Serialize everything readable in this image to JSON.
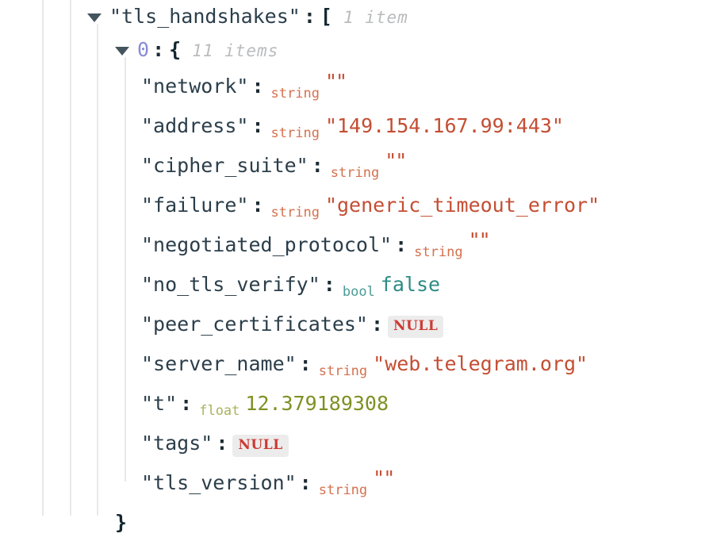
{
  "viewer": {
    "root": {
      "key": "\"tls_handshakes\"",
      "colon": ":",
      "bracket": "[",
      "count": "1 item",
      "expanded_icon": "triangle-down-icon"
    },
    "item": {
      "index": "0",
      "colon": ":",
      "bracket": "{",
      "count": "11 items",
      "expanded_icon": "triangle-down-icon"
    },
    "closing_brace": "}",
    "colon": ":",
    "fields": [
      {
        "key": "\"network\"",
        "type": "string",
        "value": "\"\"",
        "value_kind": "empty-string"
      },
      {
        "key": "\"address\"",
        "type": "string",
        "value": "\"149.154.167.99:443\"",
        "value_kind": "string"
      },
      {
        "key": "\"cipher_suite\"",
        "type": "string",
        "value": "\"\"",
        "value_kind": "empty-string"
      },
      {
        "key": "\"failure\"",
        "type": "string",
        "value": "\"generic_timeout_error\"",
        "value_kind": "string"
      },
      {
        "key": "\"negotiated_protocol\"",
        "type": "string",
        "value": "\"\"",
        "value_kind": "empty-string"
      },
      {
        "key": "\"no_tls_verify\"",
        "type": "bool",
        "value": "false",
        "value_kind": "bool"
      },
      {
        "key": "\"peer_certificates\"",
        "type": "",
        "value": "NULL",
        "value_kind": "null"
      },
      {
        "key": "\"server_name\"",
        "type": "string",
        "value": "\"web.telegram.org\"",
        "value_kind": "string"
      },
      {
        "key": "\"t\"",
        "type": "float",
        "value": "12.379189308",
        "value_kind": "float"
      },
      {
        "key": "\"tags\"",
        "type": "",
        "value": "NULL",
        "value_kind": "null"
      },
      {
        "key": "\"tls_version\"",
        "type": "string",
        "value": "\"\"",
        "value_kind": "empty-string"
      }
    ]
  },
  "colors": {
    "key": "#2b3e4a",
    "index": "#8a8ad6",
    "string_type": "#d4714e",
    "string_value": "#c44e33",
    "bool": "#2e8b85",
    "float": "#7f9023",
    "null_text": "#cc3b33",
    "null_bg": "#ececec",
    "count": "#b9bbbd",
    "guide": "#e8e8e8"
  }
}
